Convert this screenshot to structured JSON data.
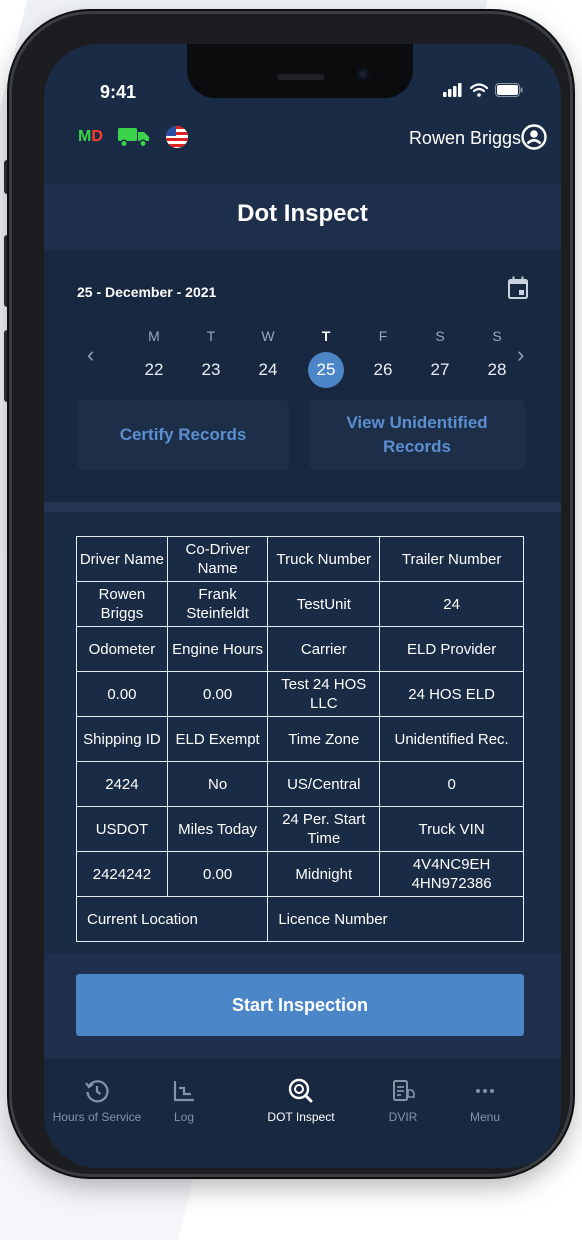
{
  "status": {
    "time": "9:41"
  },
  "topbar": {
    "md_m": "M",
    "md_d": "D",
    "user_name": "Rowen Briggs"
  },
  "header": {
    "title": "Dot Inspect"
  },
  "date": {
    "label": "25 - December - 2021"
  },
  "week": [
    {
      "letter": "M",
      "num": "22",
      "selected": false
    },
    {
      "letter": "T",
      "num": "23",
      "selected": false
    },
    {
      "letter": "W",
      "num": "24",
      "selected": false
    },
    {
      "letter": "T",
      "num": "25",
      "selected": true
    },
    {
      "letter": "F",
      "num": "26",
      "selected": false
    },
    {
      "letter": "S",
      "num": "27",
      "selected": false
    },
    {
      "letter": "S",
      "num": "28",
      "selected": false
    }
  ],
  "actions": {
    "certify": "Certify Records",
    "view_unidentified": "View Unidentified Records"
  },
  "table": {
    "rows": [
      [
        "Driver Name",
        "Co-Driver Name",
        "Truck Number",
        "Trailer Number"
      ],
      [
        "Rowen Briggs",
        "Frank Steinfeldt",
        "TestUnit",
        "24"
      ],
      [
        "Odometer",
        "Engine Hours",
        "Carrier",
        "ELD Provider"
      ],
      [
        "0.00",
        "0.00",
        "Test 24 HOS LLC",
        "24 HOS ELD"
      ],
      [
        "Shipping ID",
        "ELD Exempt",
        "Time Zone",
        "Unidentified Rec."
      ],
      [
        "2424",
        "No",
        "US/Central",
        "0"
      ],
      [
        "USDOT",
        "Miles Today",
        "24 Per. Start Time",
        "Truck VIN"
      ],
      [
        "2424242",
        "0.00",
        "Midnight",
        "4V4NC9EH 4HN972386"
      ]
    ],
    "last_row": [
      "Current Location",
      "Licence Number"
    ]
  },
  "start_button": "Start Inspection",
  "nav": [
    {
      "label": "Hours of Service",
      "icon": "history-clock-icon",
      "active": false
    },
    {
      "label": "Log",
      "icon": "log-chart-icon",
      "active": false
    },
    {
      "label": "DOT Inspect",
      "icon": "dot-inspect-icon",
      "active": true
    },
    {
      "label": "DVIR",
      "icon": "dvir-clipboard-icon",
      "active": false
    },
    {
      "label": "Menu",
      "icon": "more-dots-icon",
      "active": false
    }
  ],
  "colors": {
    "screen_bg": "#1a2b45",
    "accent": "#4a86c8",
    "selected_day": "#4d86c6",
    "link": "#5b8fd0"
  }
}
